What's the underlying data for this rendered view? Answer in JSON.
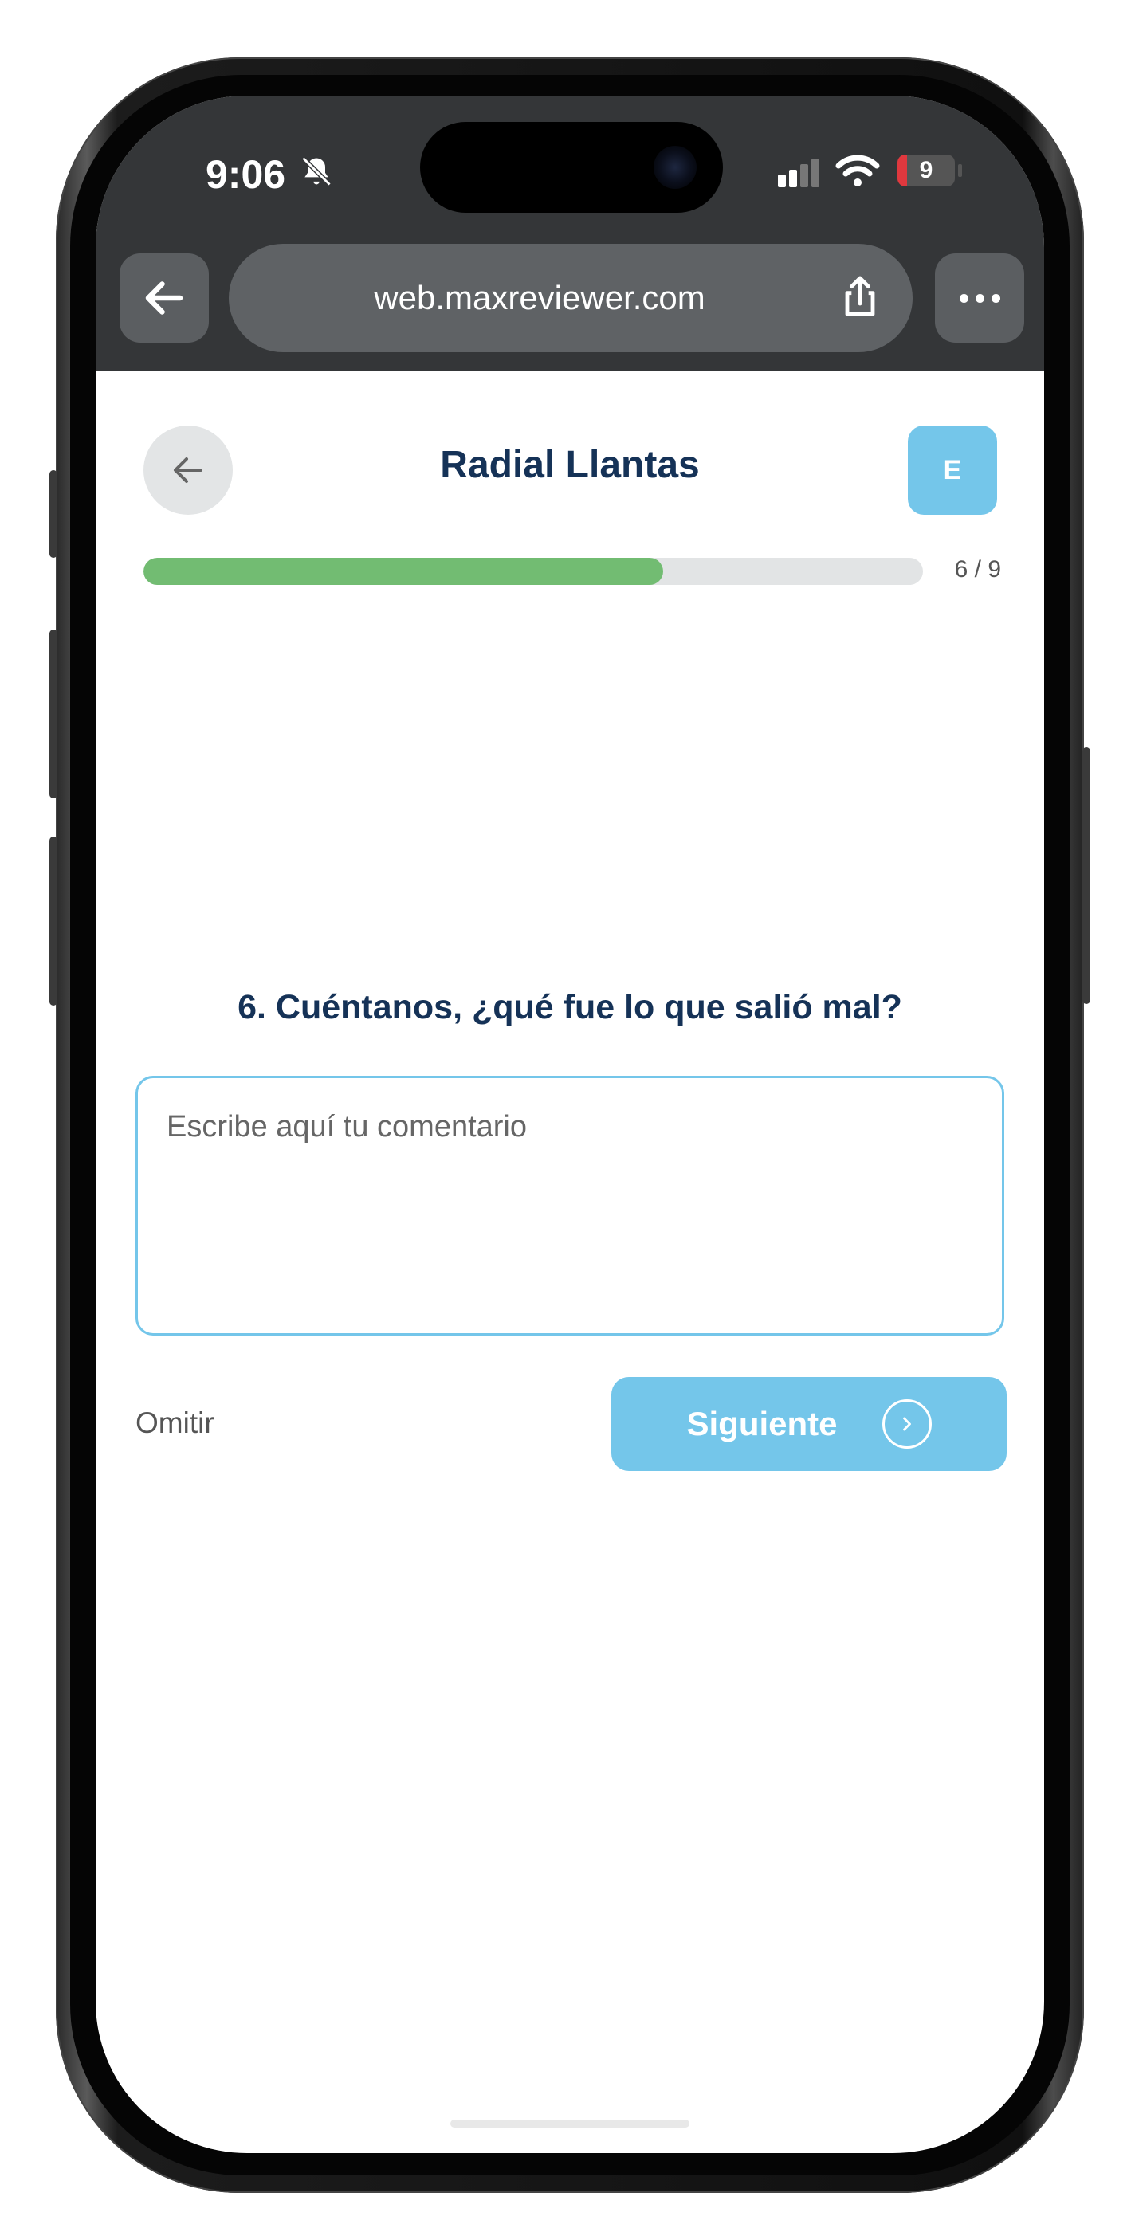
{
  "status_bar": {
    "time": "9:06",
    "battery": "9",
    "icons": [
      "bell-slash-icon",
      "signal-icon",
      "wifi-icon",
      "battery-icon"
    ]
  },
  "browser": {
    "url": "web.maxreviewer.com",
    "icons": [
      "arrow-left-icon",
      "share-icon",
      "more-icon"
    ]
  },
  "header": {
    "title": "Radial Llantas",
    "avatar_initial": "E"
  },
  "progress": {
    "current": 6,
    "total": 9,
    "label": "6 / 9",
    "fraction": 0.667
  },
  "question": {
    "text": "6. Cuéntanos, ¿qué fue lo que salió mal?",
    "placeholder": "Escribe aquí tu comentario"
  },
  "actions": {
    "skip_label": "Omitir",
    "next_label": "Siguiente"
  },
  "colors": {
    "accent": "#74c6ea",
    "title": "#153257",
    "progress": "#72bc72",
    "chrome": "#343638"
  }
}
